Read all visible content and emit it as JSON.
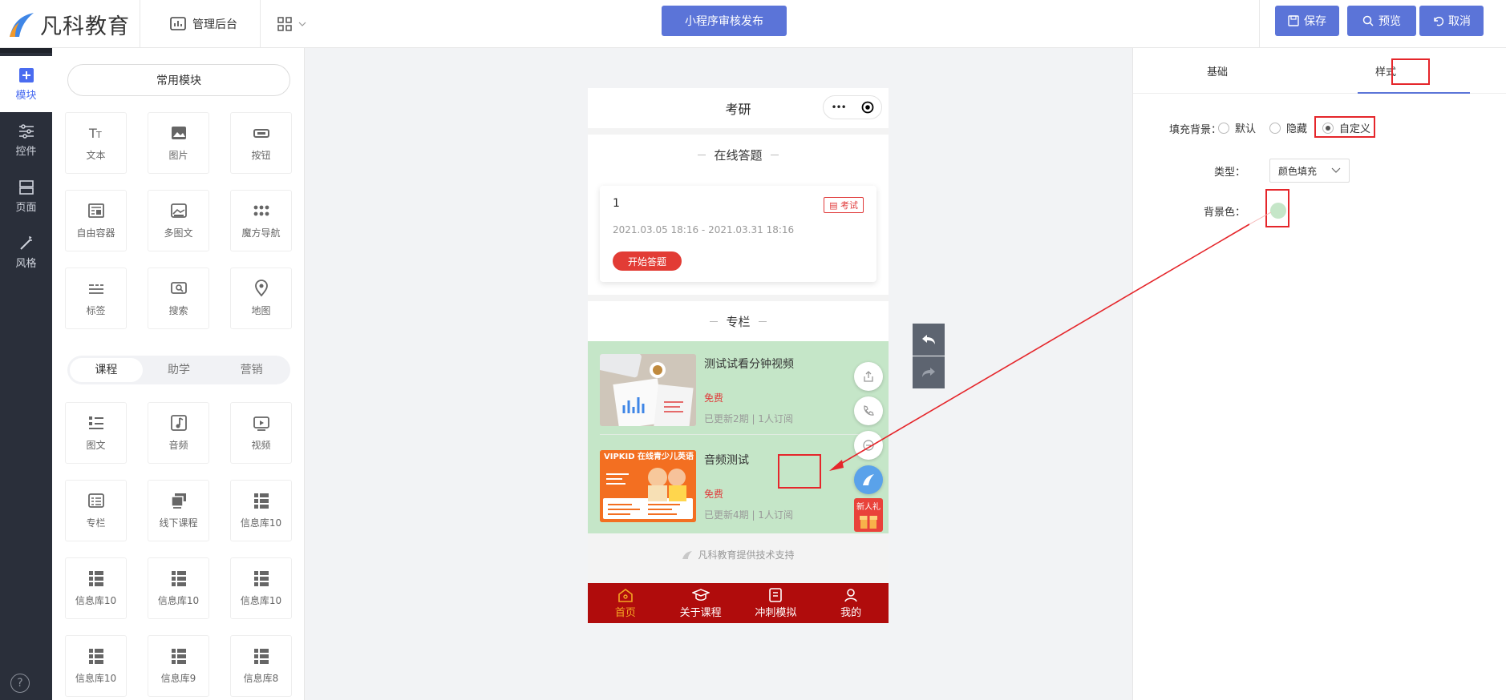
{
  "header": {
    "brand": "凡科教育",
    "admin_label": "管理后台",
    "publish_button": "小程序审核发布",
    "save_button": "保存",
    "preview_button": "预览",
    "cancel_button": "取消"
  },
  "leftbar": {
    "items": [
      {
        "label": "模块",
        "icon": "plus-square-icon"
      },
      {
        "label": "控件",
        "icon": "sliders-icon"
      },
      {
        "label": "页面",
        "icon": "page-icon"
      },
      {
        "label": "风格",
        "icon": "magic-wand-icon"
      }
    ],
    "help_icon": "question-icon"
  },
  "modules": {
    "common_title": "常用模块",
    "common": [
      {
        "label": "文本",
        "icon": "text-icon"
      },
      {
        "label": "图片",
        "icon": "image-icon"
      },
      {
        "label": "按钮",
        "icon": "button-icon"
      },
      {
        "label": "自由容器",
        "icon": "container-icon"
      },
      {
        "label": "多图文",
        "icon": "multi-image-icon"
      },
      {
        "label": "魔方导航",
        "icon": "dots-grid-icon"
      },
      {
        "label": "标签",
        "icon": "tag-icon"
      },
      {
        "label": "搜索",
        "icon": "search-icon"
      },
      {
        "label": "地图",
        "icon": "map-pin-icon"
      }
    ],
    "tabs": [
      "课程",
      "助学",
      "营销"
    ],
    "active_tab": "课程",
    "course": [
      {
        "label": "图文",
        "icon": "list-icon"
      },
      {
        "label": "音频",
        "icon": "music-icon"
      },
      {
        "label": "视频",
        "icon": "video-icon"
      },
      {
        "label": "专栏",
        "icon": "column-icon"
      },
      {
        "label": "线下课程",
        "icon": "offline-course-icon"
      },
      {
        "label": "信息库10",
        "icon": "grid-icon"
      },
      {
        "label": "信息库10",
        "icon": "grid-icon"
      },
      {
        "label": "信息库10",
        "icon": "grid-icon"
      },
      {
        "label": "信息库10",
        "icon": "grid-icon"
      },
      {
        "label": "信息库10",
        "icon": "grid-icon"
      },
      {
        "label": "信息库9",
        "icon": "grid-icon"
      },
      {
        "label": "信息库8",
        "icon": "grid-icon"
      }
    ]
  },
  "phone": {
    "title": "考研",
    "capsule_dots": "•••",
    "quiz_section": "在线答题",
    "quiz_card": {
      "name": "1",
      "tag": "考试",
      "time": "2021.03.05 18:16 - 2021.03.31 18:16",
      "start_button": "开始答题"
    },
    "column_section": "专栏",
    "courses": [
      {
        "title": "测试试看分钟视频",
        "price": "免费",
        "meta": "已更新2期 | 1人订阅"
      },
      {
        "title": "音频测试",
        "price": "免费",
        "meta": "已更新4期 | 1人订阅",
        "thumb_text": "VIPKID 在线青少儿英语"
      }
    ],
    "gift_label": "新人礼",
    "support_text": "凡科教育提供技术支持",
    "tabbar": [
      {
        "label": "首页",
        "icon": "home-icon",
        "active": true
      },
      {
        "label": "关于课程",
        "icon": "graduation-cap-icon",
        "active": false
      },
      {
        "label": "冲刺模拟",
        "icon": "clipboard-icon",
        "active": false
      },
      {
        "label": "我的",
        "icon": "user-icon",
        "active": false
      }
    ]
  },
  "right": {
    "tabs": [
      "基础",
      "样式"
    ],
    "active_tab": "样式",
    "fill_label": "填充背景：",
    "fill_options": [
      "默认",
      "隐藏",
      "自定义"
    ],
    "fill_selected": "自定义",
    "type_label": "类型：",
    "type_value": "颜色填充",
    "bgcolor_label": "背景色：",
    "bgcolor": "#c5e6c8"
  },
  "colors": {
    "accent": "#5b74d8",
    "tabbar": "#b00c0c",
    "red": "#e23c35",
    "green_bg": "#c5e6c8"
  }
}
